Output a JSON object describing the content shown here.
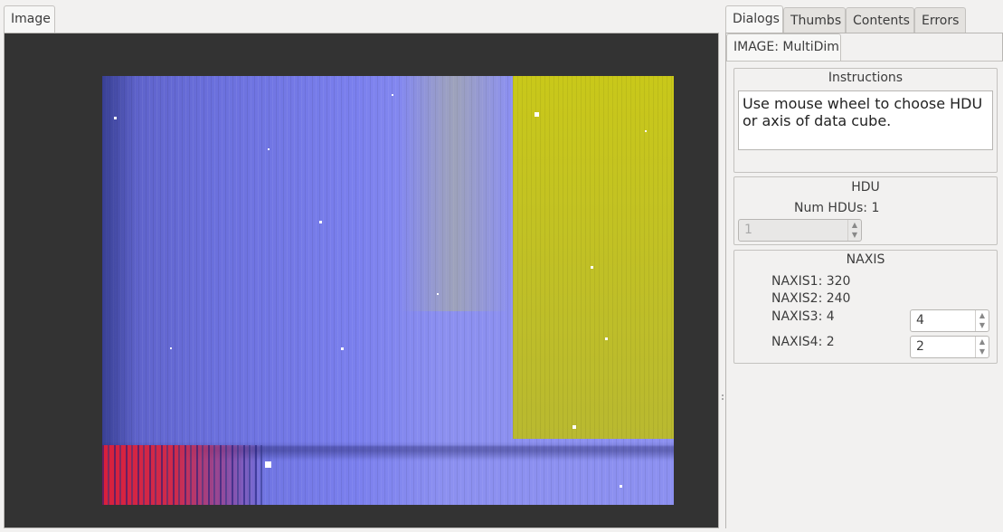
{
  "left_tabs": [
    {
      "label": "Image",
      "active": true
    }
  ],
  "right_tabs": [
    {
      "label": "Dialogs",
      "active": true
    },
    {
      "label": "Thumbs",
      "active": false
    },
    {
      "label": "Contents",
      "active": false
    },
    {
      "label": "Errors",
      "active": false
    }
  ],
  "sub_tab": {
    "label": "IMAGE: MultiDim"
  },
  "instructions": {
    "title": "Instructions",
    "text": "Use mouse wheel to choose HDU or axis of data cube."
  },
  "hdu": {
    "title": "HDU",
    "num_hdus_label": "Num HDUs: 1",
    "selected": "1"
  },
  "naxis": {
    "title": "NAXIS",
    "naxis1": "NAXIS1: 320",
    "naxis2": "NAXIS2: 240",
    "naxis3": "NAXIS3: 4",
    "naxis4": "NAXIS4: 2",
    "naxis3_value": "4",
    "naxis4_value": "2"
  },
  "colors": {
    "viewer_background": "#333333",
    "image_blue": "#7b80ee",
    "image_yellow": "#c9c81a",
    "image_red": "#d8203c"
  }
}
